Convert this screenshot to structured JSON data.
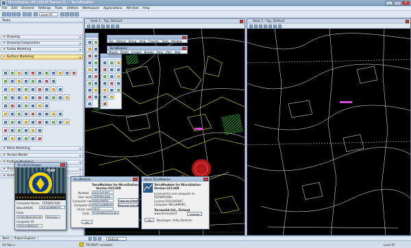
{
  "app": {
    "title": "MicroStation V8i (SELECTseries 3) — TerraModeler",
    "win_min": "_",
    "win_max": "□",
    "win_close": "x"
  },
  "menu": [
    "File",
    "Edit",
    "Element",
    "Settings",
    "Tools",
    "Utilities",
    "Workspace",
    "Applications",
    "Window",
    "Help"
  ],
  "toolbar": {
    "active_level": "Level 97"
  },
  "left_panel": {
    "title": "Tasks",
    "sections": [
      {
        "label": "Drawing"
      },
      {
        "label": "Drawing Composition"
      },
      {
        "label": "Solids Modeling"
      },
      {
        "label": "Surface Modeling"
      },
      {
        "label": "Mesh Modeling"
      },
      {
        "label": "Terrain Model"
      },
      {
        "label": "Feature Modeling"
      },
      {
        "label": "Visualization"
      },
      {
        "label": "Animation"
      }
    ],
    "tabs": [
      "Tasks",
      "Project Explorer"
    ]
  },
  "view1": {
    "title": "View 1 - Top, Default"
  },
  "view2": {
    "title": "View 2 - Top, Default"
  },
  "floating_menu": {
    "title": "TerraModeler",
    "items": [
      "Mouse",
      "Points",
      "Images",
      "Breaks",
      "View",
      "Utils",
      "Help"
    ],
    "items_top": [
      "File",
      "Output",
      "Setup",
      "View",
      "Classify",
      "Tools",
      "Window",
      "Help"
    ]
  },
  "register_dialog": {
    "title": "TerraModeler",
    "heading": "TerraModeler for MicroStation",
    "version": "Version 015.009",
    "fields": [
      {
        "label": "Number",
        "value": "0101301907"
      },
      {
        "label": "User name",
        "value": "TERSPACADA"
      },
      {
        "label": "Computer name",
        "value": "WILLIAMSPC"
      },
      {
        "label": "Computer ID",
        "value": "0002A0BBB059"
      },
      {
        "label": "Check sum",
        "value": "9812"
      },
      {
        "label": "Code",
        "value": "FF8E0BB4A2D44E11"
      }
    ],
    "copy_button": "Copy for Email",
    "request_button": "Request license",
    "ok_button": "OK"
  },
  "about_dialog": {
    "title": "About TerraModeler",
    "heading": "TerraModeler for MicroStation",
    "version": "Version 015.009",
    "licensed_line": "Licensed for one computer to",
    "licensee": "FERSPACADA",
    "license_no": "License 0101301907",
    "computer_line": "Computer WILLIAMSPC",
    "company": "Terrasolid Ltd., Finland",
    "site": "www.terrasolid.fi",
    "license_button": "License",
    "developer_line": "Developer: Arttu Soininen",
    "ok_button": "OK"
  },
  "keygen": {
    "title": "TerraSolid Keygen",
    "banner_label": "TEAM",
    "labels": [
      {
        "label": "Computer Name",
        "value": "FERSPACADA"
      },
      {
        "label": "WILLIAMSPC",
        "value": "0002A0BBB059"
      },
      {
        "label": "Code",
        "value": ""
      },
      {
        "label": "FF8E0BB4A2D44E11",
        "value": "Windows"
      },
      {
        "label": "Computer ID",
        "value": ""
      },
      {
        "label": "0002A0BBB059",
        "value": ""
      }
    ]
  },
  "status": {
    "left": "Alt Tabs ▾",
    "unloaded": "TRCMDPT unloaded",
    "default_views": "Default Views",
    "level": "Level 97"
  },
  "colors": {
    "lines_white": "#ffffff",
    "lines_yellow": "#e8e84a",
    "hatch_green": "#2fb22f",
    "highlight_magenta": "#e04adf",
    "seal_red": "#b3161b"
  }
}
